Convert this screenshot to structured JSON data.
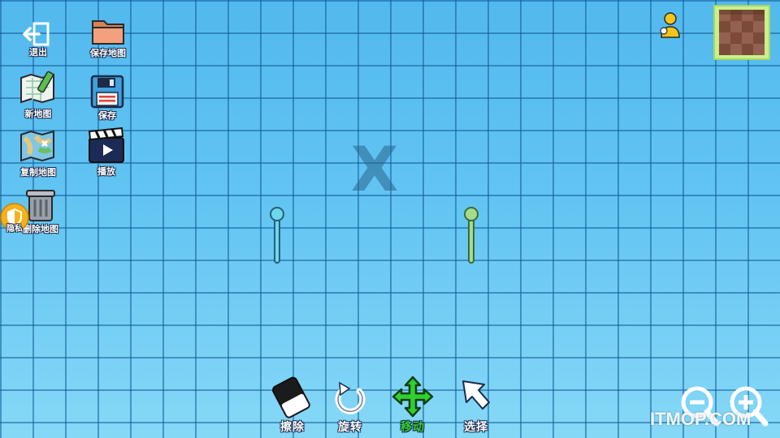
{
  "left_menu": {
    "exit": "退出",
    "save_map": "保存地图",
    "new_map": "新地图",
    "save": "保存",
    "copy_map": "复制地图",
    "play": "播放",
    "delete_map": "删除地图"
  },
  "privacy_badge": "隐私",
  "toolbar": {
    "erase": "擦除",
    "rotate": "旋转",
    "move": "移动",
    "select": "选择"
  },
  "watermark": "ITMOP.COM"
}
